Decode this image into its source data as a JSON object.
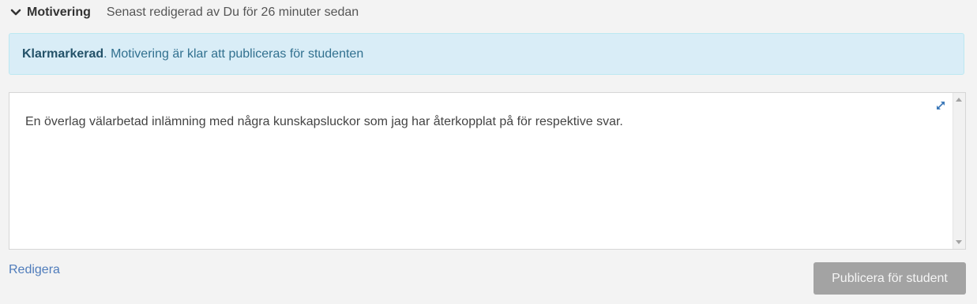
{
  "header": {
    "chevron_icon": "chevron-down-icon",
    "title": "Motivering",
    "meta": "Senast redigerad av Du för 26 minuter sedan"
  },
  "alert": {
    "status": "Klarmarkerad",
    "message": ". Motivering är klar att publiceras för studenten",
    "colors": {
      "background": "#d9edf7",
      "text": "#31708f"
    }
  },
  "editor": {
    "text": "En överlag välarbetad inlämning med några kunskapsluckor som jag har återkopplat på för respektive svar.",
    "expand_icon": "expand-icon"
  },
  "actions": {
    "edit_label": "Redigera",
    "publish_label": "Publicera för student"
  }
}
